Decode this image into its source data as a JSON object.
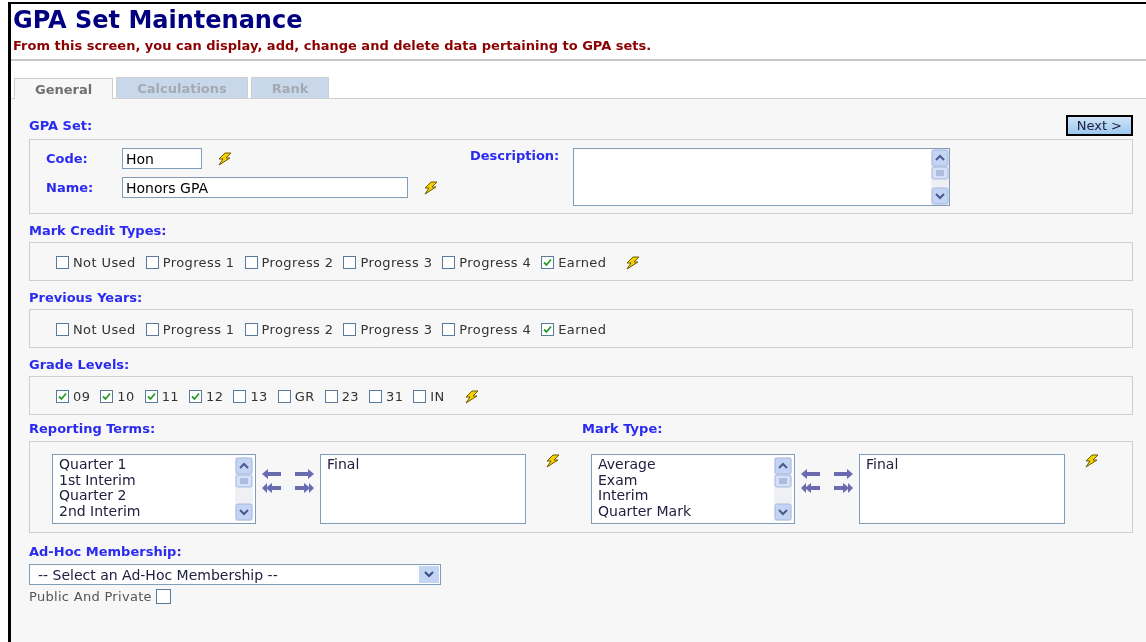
{
  "header": {
    "title": "GPA Set Maintenance",
    "subtitle": "From this screen, you can display, add, change and delete data pertaining to GPA sets."
  },
  "tabs": [
    {
      "label": "General",
      "selected": true
    },
    {
      "label": "Calculations",
      "selected": false
    },
    {
      "label": "Rank",
      "selected": false
    }
  ],
  "gpa_set": {
    "heading": "GPA Set:",
    "next_button": "Next >",
    "code": {
      "label": "Code:",
      "value": "Hon",
      "required": true
    },
    "name": {
      "label": "Name:",
      "value": "Honors GPA",
      "required": true
    },
    "description": {
      "label": "Description:"
    }
  },
  "checkbox_groups": [
    {
      "heading": "Mark Credit Types:",
      "required": true,
      "items": [
        {
          "label": "Not Used",
          "checked": false
        },
        {
          "label": "Progress 1",
          "checked": false
        },
        {
          "label": "Progress 2",
          "checked": false
        },
        {
          "label": "Progress 3",
          "checked": false
        },
        {
          "label": "Progress 4",
          "checked": false
        },
        {
          "label": "Earned",
          "checked": true
        }
      ]
    },
    {
      "heading": "Previous Years:",
      "required": false,
      "items": [
        {
          "label": "Not Used",
          "checked": false
        },
        {
          "label": "Progress 1",
          "checked": false
        },
        {
          "label": "Progress 2",
          "checked": false
        },
        {
          "label": "Progress 3",
          "checked": false
        },
        {
          "label": "Progress 4",
          "checked": false
        },
        {
          "label": "Earned",
          "checked": true
        }
      ]
    },
    {
      "heading": "Grade Levels:",
      "required": true,
      "items": [
        {
          "label": "09",
          "checked": true
        },
        {
          "label": "10",
          "checked": true
        },
        {
          "label": "11",
          "checked": true
        },
        {
          "label": "12",
          "checked": true
        },
        {
          "label": "13",
          "checked": false
        },
        {
          "label": "GR",
          "checked": false
        },
        {
          "label": "23",
          "checked": false
        },
        {
          "label": "31",
          "checked": false
        },
        {
          "label": "IN",
          "checked": false
        }
      ]
    }
  ],
  "list_pickers": [
    {
      "heading": "Reporting Terms:",
      "required": true,
      "available": [
        "Quarter 1",
        "1st Interim",
        "Quarter 2",
        "2nd Interim"
      ],
      "chosen": [
        "Final"
      ]
    },
    {
      "heading": "Mark Type:",
      "required": true,
      "available": [
        "Average",
        "Exam",
        "Interim",
        "Quarter Mark"
      ],
      "chosen": [
        "Final"
      ]
    }
  ],
  "adhoc": {
    "heading": "Ad-Hoc Membership:",
    "value": "-- Select an Ad-Hoc Membership --"
  },
  "public_private": {
    "label": "Public And Private",
    "checked": false
  }
}
